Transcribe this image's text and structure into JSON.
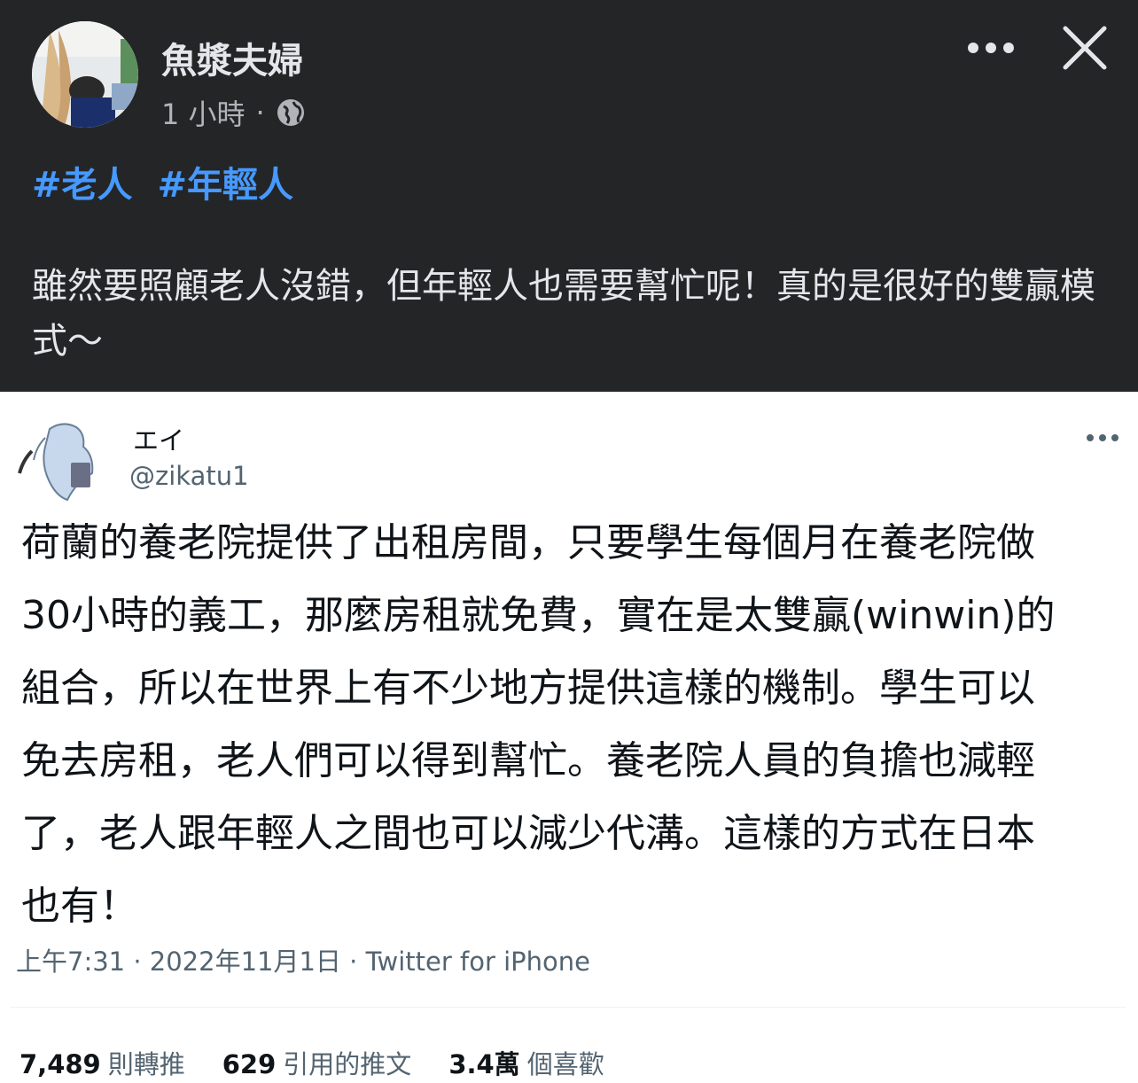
{
  "post": {
    "author": "魚漿夫婦",
    "time": "1 小時",
    "separator": "·",
    "hashtags": [
      "#老人",
      "#年輕人"
    ],
    "text": "雖然要照顧老人沒錯，但年輕人也需要幫忙呢！真的是很好的雙贏模式～",
    "icons": {
      "more": "more-options-icon",
      "close": "close-icon",
      "audience": "globe-icon"
    }
  },
  "tweet": {
    "display_name": "エイ",
    "handle": "@zikatu1",
    "text": "荷蘭的養老院提供了出租房間，只要學生每個月在養老院做30小時的義工，那麼房租就免費，實在是太雙贏(winwin)的組合，所以在世界上有不少地方提供這樣的機制。學生可以免去房租，老人們可以得到幫忙。養老院人員的負擔也減輕了，老人跟年輕人之間也可以減少代溝。這樣的方式在日本也有！",
    "timestamp": "上午7:31 · 2022年11月1日 · Twitter for iPhone",
    "stats": {
      "retweets": {
        "value": "7,489",
        "label": "則轉推"
      },
      "quotes": {
        "value": "629",
        "label": "引用的推文"
      },
      "likes": {
        "value": "3.4萬",
        "label": "個喜歡"
      }
    }
  },
  "colors": {
    "fb_bg": "#242526",
    "hashtag": "#4599ff",
    "text_light": "#e4e6eb",
    "muted": "#b0b3b8",
    "tw_text": "#0f1419",
    "tw_muted": "#536471"
  }
}
